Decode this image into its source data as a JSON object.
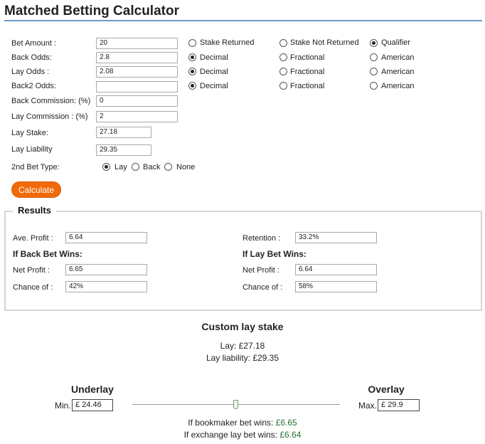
{
  "title": "Matched Betting Calculator",
  "form": {
    "bet_amount": {
      "label": "Bet Amount :",
      "value": "20"
    },
    "back_odds": {
      "label": "Back Odds:",
      "value": "2.8"
    },
    "lay_odds": {
      "label": "Lay Odds :",
      "value": "2.08"
    },
    "back2_odds": {
      "label": "Back2 Odds:",
      "value": ""
    },
    "back_commission": {
      "label": "Back Commission: (%)",
      "value": "0"
    },
    "lay_commission": {
      "label": "Lay Commission : (%)",
      "value": "2"
    },
    "lay_stake": {
      "label": "Lay Stake:",
      "value": "27.18"
    },
    "lay_liability": {
      "label": "Lay Liability",
      "value": "29.35"
    },
    "second_bet_type": {
      "label": "2nd Bet Type:",
      "options": [
        "Lay",
        "Back",
        "None"
      ],
      "selected": "Lay"
    }
  },
  "bet_type_options": {
    "options": [
      "Stake Returned",
      "Stake Not Returned",
      "Qualifier"
    ],
    "selected": "Qualifier"
  },
  "odds_format_options": [
    "Decimal",
    "Fractional",
    "American"
  ],
  "odds_format_selected": {
    "back_odds": "Decimal",
    "lay_odds": "Decimal",
    "back2_odds": "Decimal"
  },
  "calculate_label": "Calculate",
  "results": {
    "legend": "Results",
    "ave_profit": {
      "label": "Ave. Profit :",
      "value": "6.64"
    },
    "retention": {
      "label": "Retention :",
      "value": "33.2%"
    },
    "back_wins": {
      "heading": "If Back Bet Wins:",
      "net_profit_label": "Net Profit :",
      "net_profit": "6.65",
      "chance_label": "Chance of :",
      "chance": "42%"
    },
    "lay_wins": {
      "heading": "If Lay Bet Wins:",
      "net_profit_label": "Net Profit :",
      "net_profit": "6.64",
      "chance_label": "Chance of :",
      "chance": "58%"
    }
  },
  "custom": {
    "heading": "Custom lay stake",
    "lay_label": "Lay:",
    "lay_value": "£27.18",
    "liability_label": "Lay liability:",
    "liability_value": "£29.35",
    "underlay_label": "Underlay",
    "overlay_label": "Overlay",
    "min_label": "Min.",
    "min_currency": "£",
    "min_value": "24.46",
    "max_label": "Max.",
    "max_currency": "£",
    "max_value": "29.9",
    "slider_position": 0.5,
    "bookmaker_label": "If bookmaker bet wins:",
    "bookmaker_value": "£6.65",
    "exchange_label": "If exchange lay bet wins:",
    "exchange_value": "£6.64",
    "profit_color": "#2a6e34"
  },
  "accent_color": "#f16a0a"
}
